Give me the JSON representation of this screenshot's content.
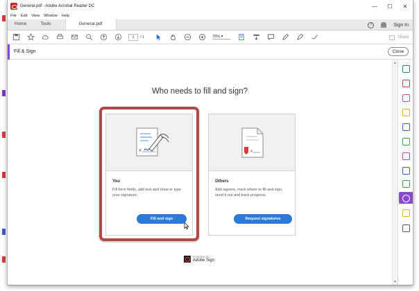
{
  "window": {
    "title": "General.pdf - Adobe Acrobat Reader DC",
    "controls": {
      "minimize": "—",
      "maximize": "☐",
      "close": "✕"
    }
  },
  "menu": [
    "File",
    "Edit",
    "View",
    "Window",
    "Help"
  ],
  "tabs": {
    "home": "Home",
    "tools": "Tools",
    "document": "General.pdf"
  },
  "header_right": {
    "help": "?",
    "sign_in": "Sign In"
  },
  "toolbar": {
    "page_current": "1",
    "page_total": "/ 1",
    "zoom": "78%",
    "share_label": "Share"
  },
  "fill_sign": {
    "title": "Fill & Sign",
    "close_label": "Close",
    "heading": "Who needs to fill and sign?",
    "you": {
      "title": "You",
      "description": "Fill form fields, add text and draw or type your signature.",
      "button": "Fill and sign"
    },
    "others": {
      "title": "Others",
      "description": "Add signers, mark where to fill and sign, send it out and track progress.",
      "button": "Request signatures"
    },
    "powered_by": "POWERED BY",
    "brand": "Adobe Sign"
  },
  "colors": {
    "accent_purple": "#8a49c7",
    "button_blue": "#2a7bd6",
    "highlight_red": "#b04848",
    "adobe_red": "#d4201e"
  },
  "right_panel_icons": [
    {
      "icon": "create-pdf-icon",
      "color": "#1e8c5a"
    },
    {
      "icon": "export-pdf-icon",
      "color": "#d23c3c"
    },
    {
      "icon": "edit-pdf-icon",
      "color": "#d04a8a"
    },
    {
      "icon": "comment-icon",
      "color": "#e6b400"
    },
    {
      "icon": "combine-files-icon",
      "color": "#3c5ad2"
    },
    {
      "icon": "organize-pages-icon",
      "color": "#2ea84a"
    },
    {
      "icon": "fill-sign-pen-icon",
      "color": "#d23c8c"
    },
    {
      "icon": "protect-icon",
      "color": "#3c5ad2"
    },
    {
      "icon": "optimize-pdf-icon",
      "color": "#2ea84a"
    },
    {
      "icon": "fill-sign-active-icon",
      "color": "#ffffff"
    },
    {
      "icon": "send-for-review-icon",
      "color": "#e6b400"
    },
    {
      "icon": "more-tools-icon",
      "color": "#555555"
    }
  ]
}
